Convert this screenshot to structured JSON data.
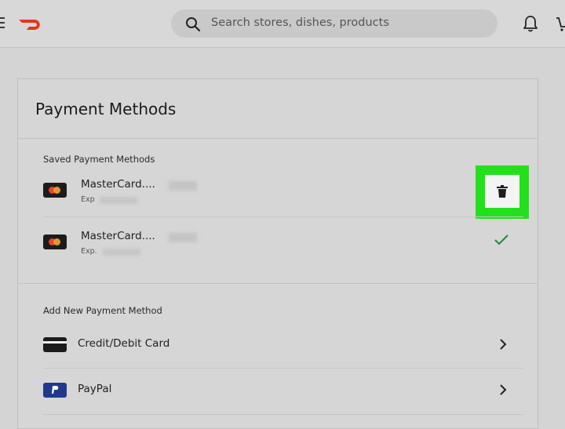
{
  "header": {
    "search_placeholder": "Search stores, dishes, products",
    "icons": [
      "menu-icon",
      "doordash-logo",
      "search-icon",
      "bell-icon",
      "cart-icon"
    ],
    "brand_color": "#e8341c"
  },
  "card": {
    "title": "Payment Methods",
    "saved_label": "Saved Payment Methods",
    "saved_methods": [
      {
        "name": "MasterCard....",
        "exp_label": "Exp",
        "action": "trash-icon",
        "highlighted": true
      },
      {
        "name": "MasterCard....",
        "exp_label": "Exp.",
        "action": "check-icon",
        "selected": true
      }
    ],
    "add_label": "Add New Payment Method",
    "add_methods": [
      {
        "label": "Credit/Debit Card",
        "icon": "card-icon"
      },
      {
        "label": "PayPal",
        "icon": "paypal-icon"
      }
    ]
  },
  "colors": {
    "highlight": "#23e01c",
    "check": "#1f8a3a",
    "paypal": "#1f3a8a"
  }
}
